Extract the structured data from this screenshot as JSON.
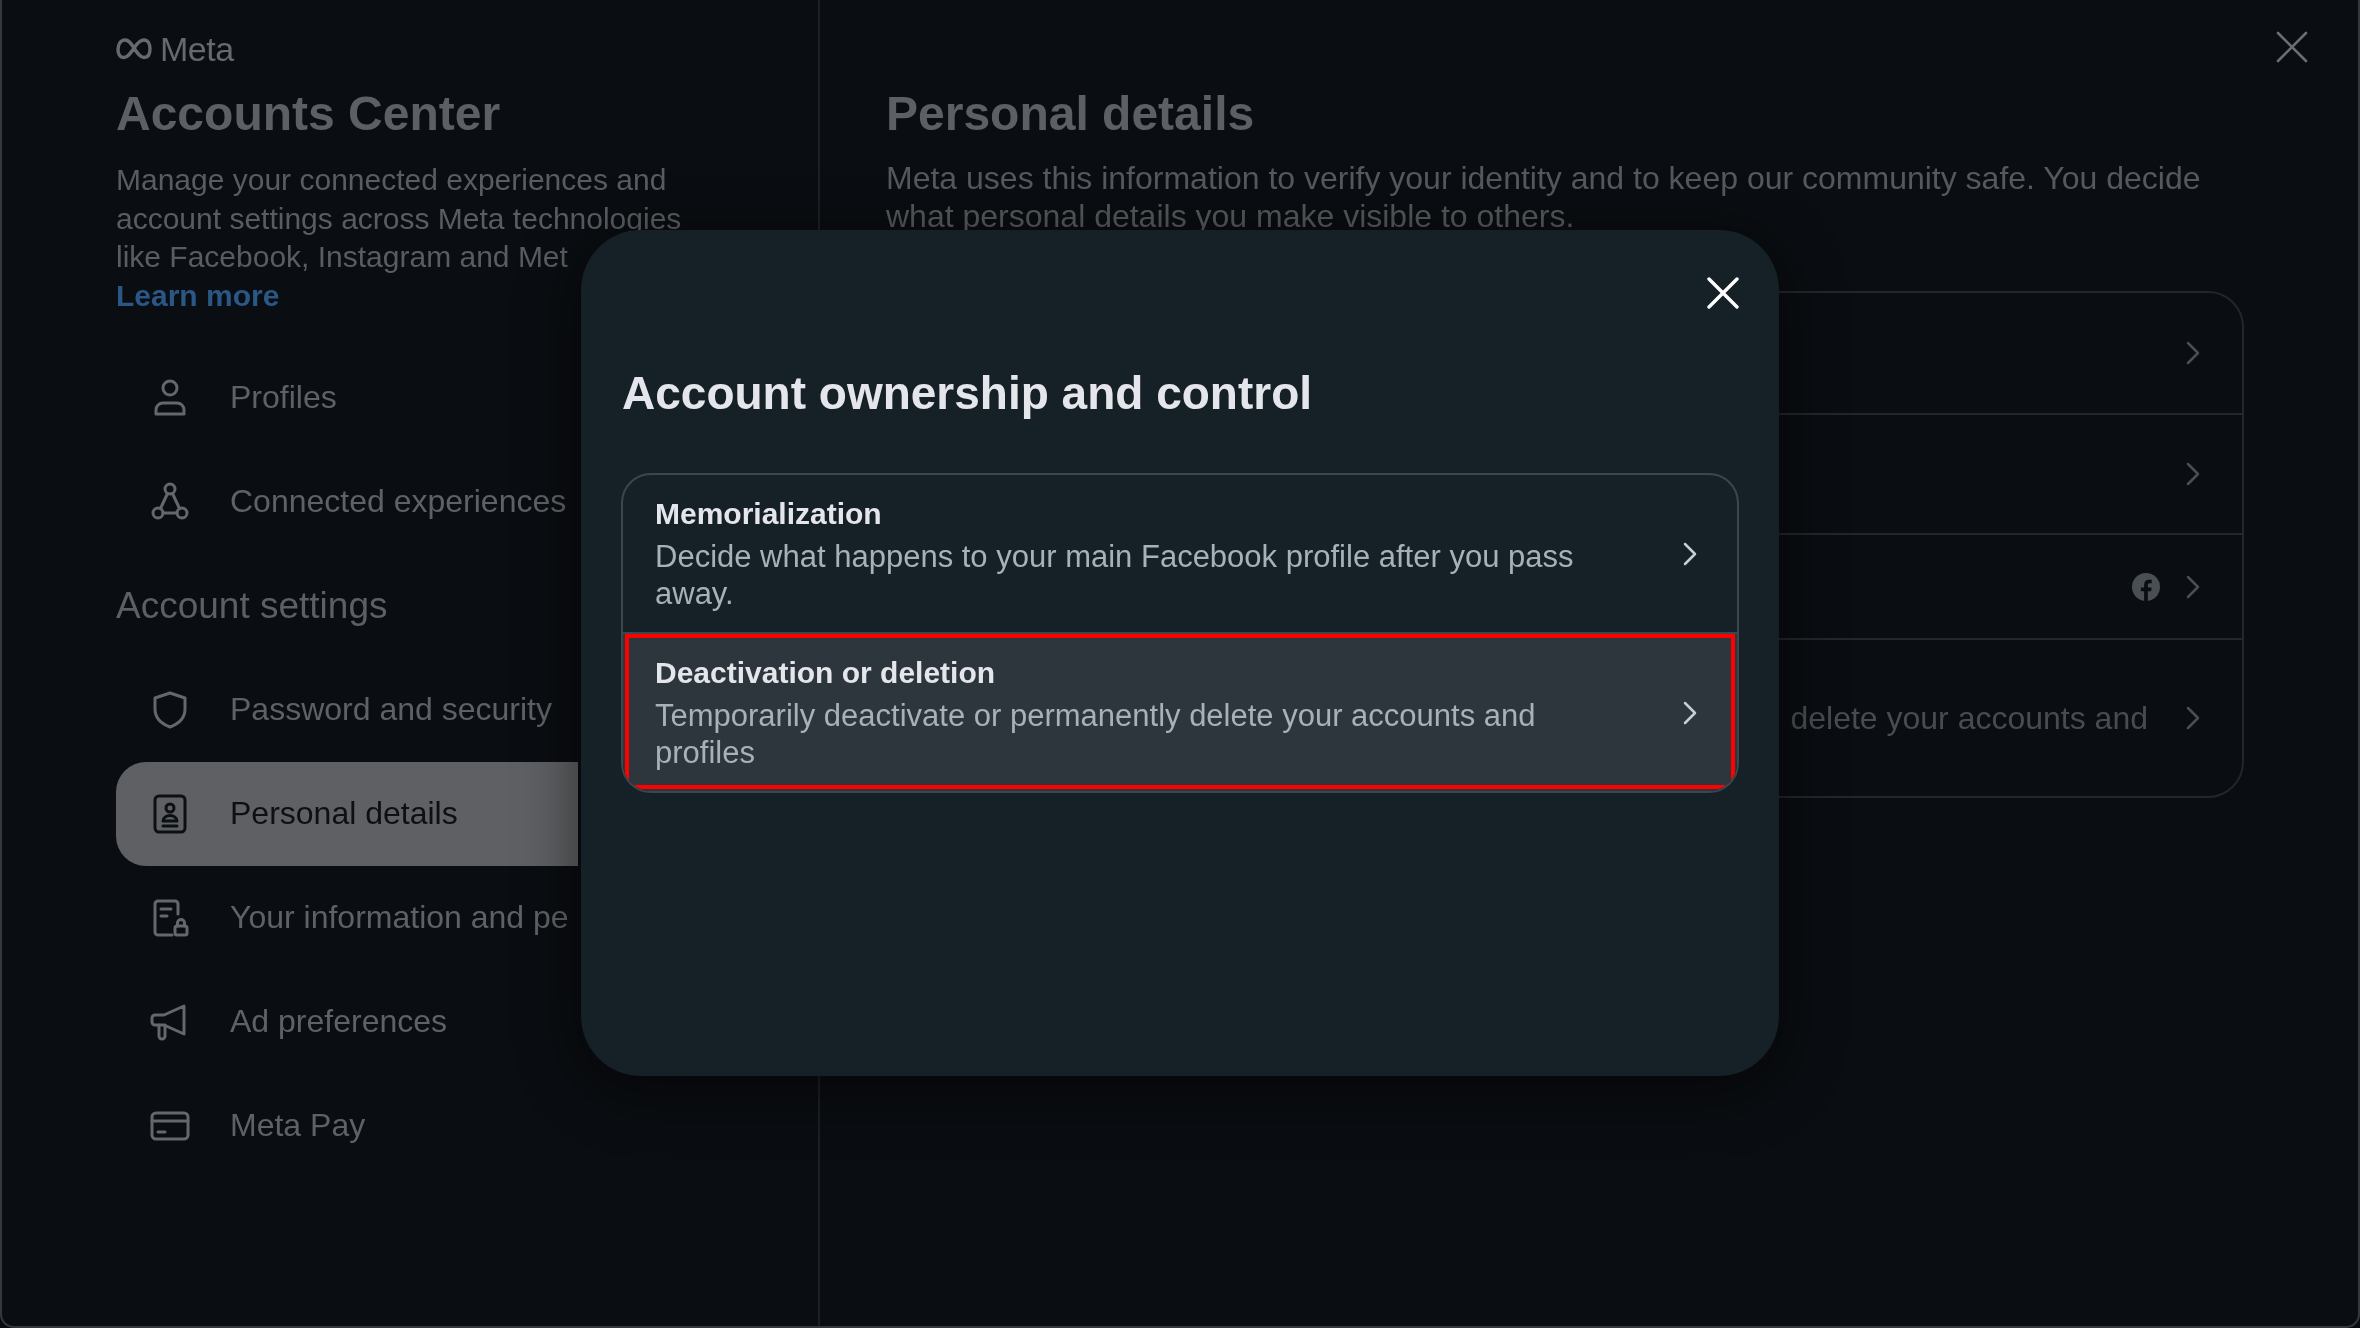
{
  "brand": {
    "name": "Meta"
  },
  "sidebar": {
    "title": "Accounts Center",
    "description": "Manage your connected experiences and account settings across Meta technologies like Facebook, Instagram and Met",
    "link": "Learn more",
    "top_items": [
      {
        "label": "Profiles",
        "kind": "person",
        "selected": false
      },
      {
        "label": "Connected experiences",
        "kind": "nodes",
        "selected": false
      }
    ],
    "section_title": "Account settings",
    "items": [
      {
        "label": "Password and security",
        "kind": "shield",
        "selected": false
      },
      {
        "label": "Personal details",
        "kind": "badge",
        "selected": true
      },
      {
        "label": "Your information and pe",
        "kind": "document",
        "selected": false
      },
      {
        "label": "Ad preferences",
        "kind": "megaphone",
        "selected": false
      },
      {
        "label": "Meta Pay",
        "kind": "card",
        "selected": false
      }
    ]
  },
  "main": {
    "title": "Personal details",
    "description": "Meta uses this information to verify your identity and to keep our community safe. You decide what personal details you make visible to others.",
    "rows": [
      {
        "kind": "plain"
      },
      {
        "kind": "plain"
      },
      {
        "kind": "facebook"
      },
      {
        "kind": "text",
        "text": "delete your accounts and"
      }
    ]
  },
  "dialog": {
    "title": "Account ownership and control",
    "options": [
      {
        "title": "Memorialization",
        "description": "Decide what happens to your main Facebook profile after you pass away.",
        "highlighted": false
      },
      {
        "title": "Deactivation or deletion",
        "description": "Temporarily deactivate or permanently delete your accounts and profiles",
        "highlighted": true
      }
    ]
  }
}
